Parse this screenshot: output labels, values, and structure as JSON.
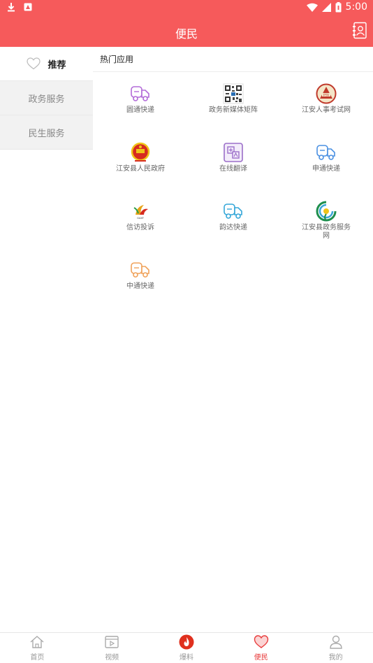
{
  "status_bar": {
    "time": "5:00"
  },
  "header": {
    "title": "便民"
  },
  "categories": [
    {
      "label": "推荐",
      "active": true
    },
    {
      "label": "政务服务",
      "active": false
    },
    {
      "label": "民生服务",
      "active": false
    }
  ],
  "section": {
    "title": "热门应用"
  },
  "apps": [
    {
      "label": "圆通快递",
      "icon": "truck-icon-purple"
    },
    {
      "label": "政务新媒体矩阵",
      "icon": "qr-code-icon"
    },
    {
      "label": "江安人事考试网",
      "icon": "exam-emblem-icon"
    },
    {
      "label": "江安县人民政府",
      "icon": "national-emblem-icon"
    },
    {
      "label": "在线翻译",
      "icon": "translate-icon"
    },
    {
      "label": "申通快递",
      "icon": "truck-icon-blue"
    },
    {
      "label": "信访投诉",
      "icon": "petition-logo-icon"
    },
    {
      "label": "韵达快递",
      "icon": "truck-icon-cyan"
    },
    {
      "label": "江安县政务服务网",
      "icon": "government-service-logo-icon"
    },
    {
      "label": "中通快递",
      "icon": "truck-icon-orange"
    }
  ],
  "tabbar": [
    {
      "label": "首页",
      "icon": "home-icon"
    },
    {
      "label": "视频",
      "icon": "video-icon"
    },
    {
      "label": "爆料",
      "icon": "fire-icon"
    },
    {
      "label": "便民",
      "icon": "heart-icon",
      "active": true
    },
    {
      "label": "我的",
      "icon": "person-icon"
    }
  ],
  "colors": {
    "brand": "#f65a5b",
    "tab_active": "#e83c3c"
  }
}
